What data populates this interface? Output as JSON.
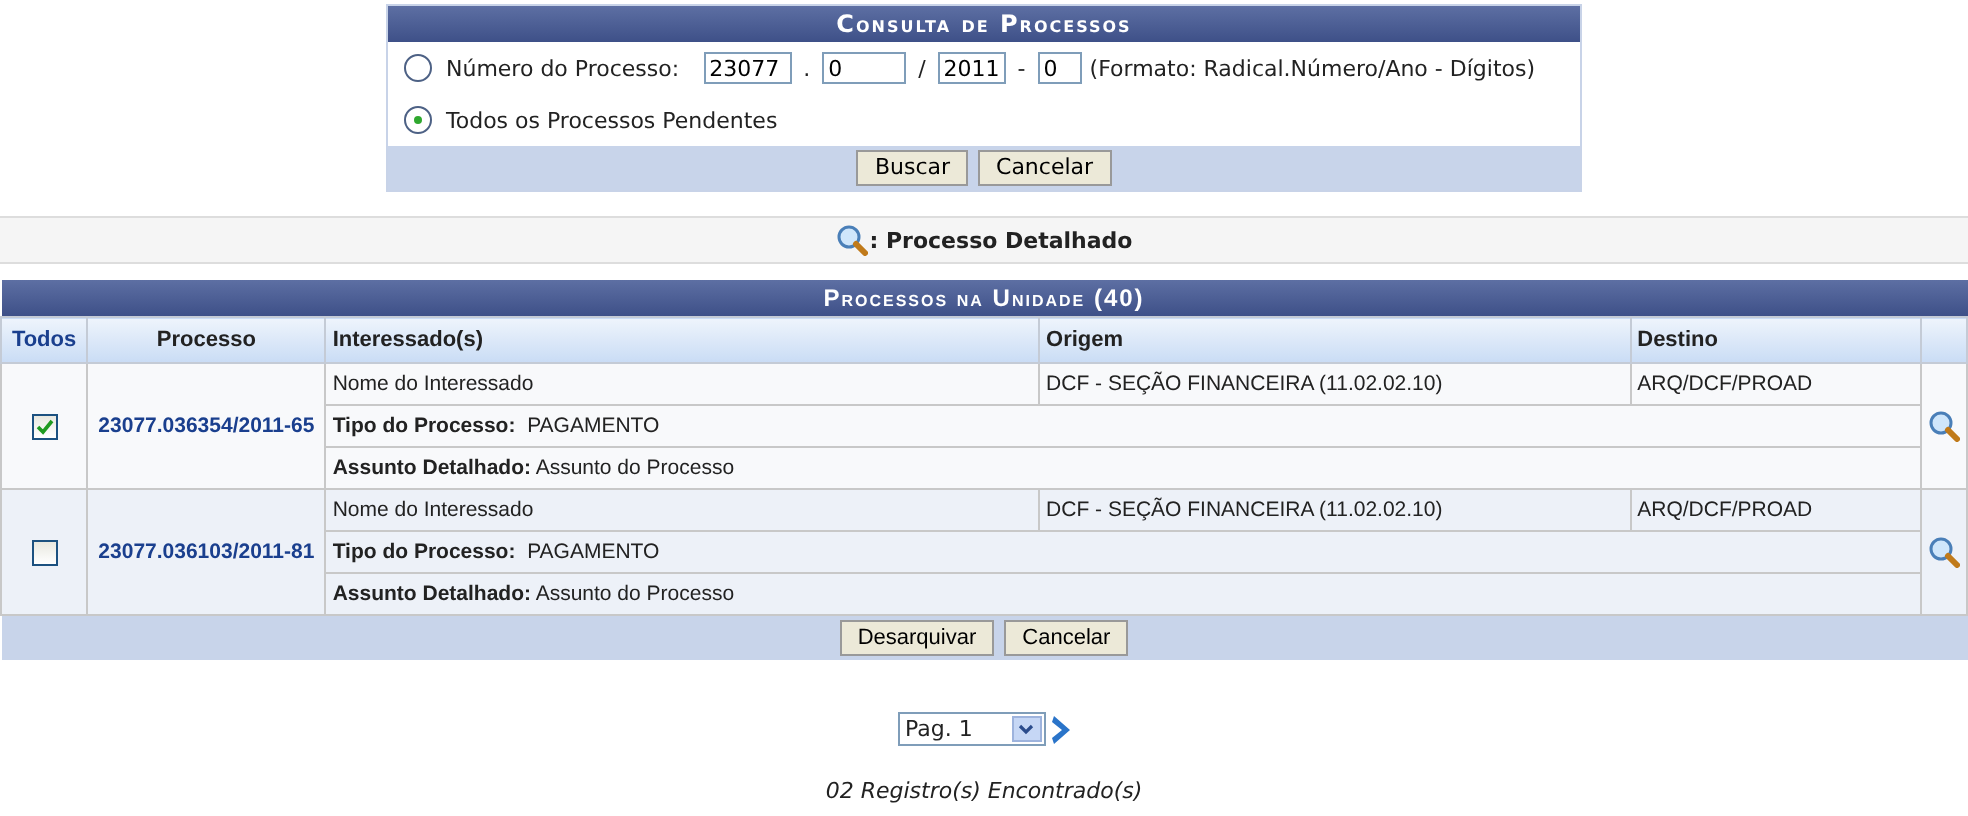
{
  "search_form": {
    "title": "Consulta de Processos",
    "options": [
      {
        "kind": "number",
        "label": "Número do Processo:",
        "selected": false
      },
      {
        "kind": "all",
        "label": "Todos os Processos Pendentes",
        "selected": true
      }
    ],
    "number_fields": [
      {
        "value": "23077",
        "separator": "."
      },
      {
        "value": "0",
        "separator": "/"
      },
      {
        "value": "2011",
        "separator": "-"
      },
      {
        "value": "0"
      }
    ],
    "format_hint": "(Formato: Radical.Número/Ano - Dígitos)",
    "buttons": [
      "Buscar",
      "Cancelar"
    ]
  },
  "legend": {
    "label": ": Processo Detalhado"
  },
  "table": {
    "title": "Processos na Unidade (40)",
    "columns": [
      "Todos",
      "Processo",
      "Interessado(s)",
      "Origem",
      "Destino"
    ],
    "rows": [
      {
        "checked": true,
        "processo": "23077.036354/2011-65",
        "interessado": "Nome do Interessado",
        "origem": "DCF - SEÇÃO FINANCEIRA (11.02.02.10)",
        "destino": "ARQ/DCF/PROAD",
        "tipo_label": "Tipo do Processo:",
        "tipo": "PAGAMENTO",
        "assunto_label": "Assunto Detalhado:",
        "assunto": "Assunto do Processo"
      },
      {
        "checked": false,
        "processo": "23077.036103/2011-81",
        "interessado": "Nome do Interessado",
        "origem": "DCF - SEÇÃO FINANCEIRA (11.02.02.10)",
        "destino": "ARQ/DCF/PROAD",
        "tipo_label": "Tipo do Processo:",
        "tipo": "PAGAMENTO",
        "assunto_label": "Assunto Detalhado:",
        "assunto": "Assunto do Processo"
      }
    ],
    "buttons": [
      "Desarquivar",
      "Cancelar"
    ]
  },
  "pager": {
    "page": "Pag. 1"
  },
  "record_count": "02 Registro(s) Encontrado(s)"
}
